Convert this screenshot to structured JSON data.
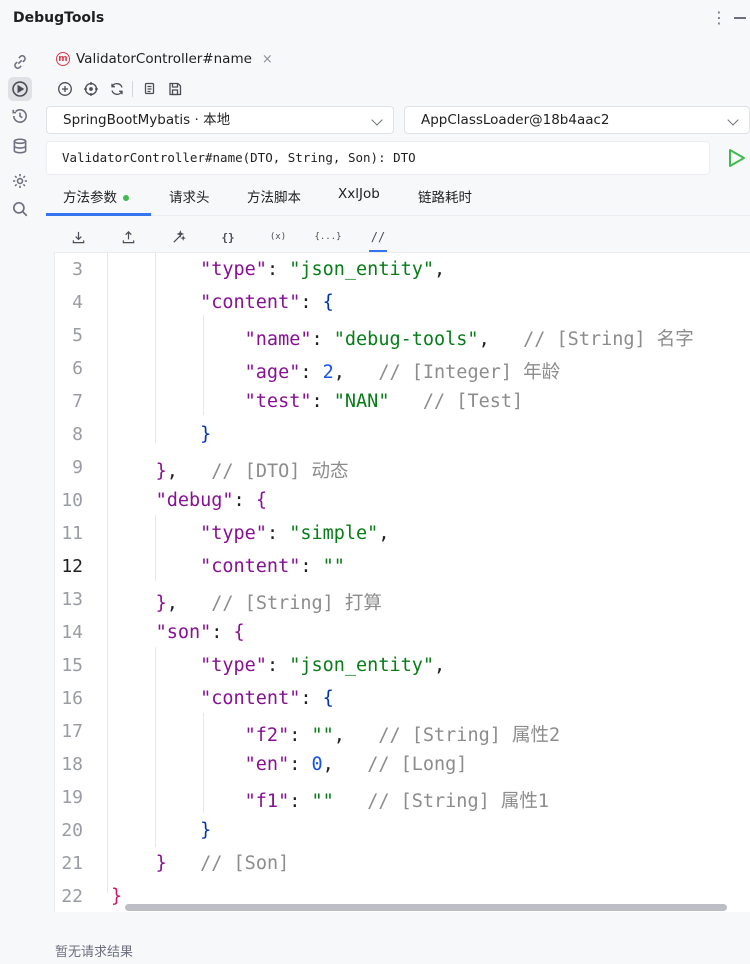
{
  "app": {
    "title": "DebugTools"
  },
  "tab": {
    "icon_letter": "m",
    "label": "ValidatorController#name",
    "close": "×"
  },
  "selects": {
    "project": "SpringBootMybatis · 本地",
    "classloader": "AppClassLoader@18b4aac2"
  },
  "signature": "ValidatorController#name(DTO, String, Son): DTO",
  "subtabs": [
    "方法参数",
    "请求头",
    "方法脚本",
    "XxlJob",
    "链路耗时"
  ],
  "editor_tools": [
    "{}",
    "(x)",
    "{...}",
    "//"
  ],
  "code": {
    "line_numbers": [
      "3",
      "4",
      "5",
      "6",
      "7",
      "8",
      "9",
      "10",
      "11",
      "12",
      "13",
      "14",
      "15",
      "16",
      "17",
      "18",
      "19",
      "20",
      "21",
      "22"
    ],
    "current_line": "12",
    "comments": {
      "name": "// [String] 名字",
      "age": "// [Integer] 年龄",
      "test": "// [Test]",
      "dto": "// [DTO] 动态",
      "debug": "// [String] 打算",
      "f2": "// [String] 属性2",
      "en": "// [Long]",
      "f1": "// [String] 属性1",
      "son": "// [Son]"
    },
    "keys": {
      "type": "\"type\"",
      "content": "\"content\"",
      "name": "\"name\"",
      "age": "\"age\"",
      "test": "\"test\"",
      "debug": "\"debug\"",
      "son": "\"son\"",
      "f2": "\"f2\"",
      "en": "\"en\"",
      "f1": "\"f1\""
    },
    "values": {
      "json_entity": "\"json_entity\"",
      "debug_tools": "\"debug-tools\"",
      "age": "2",
      "nan": "\"NAN\"",
      "simple": "\"simple\"",
      "empty": "\"\"",
      "en": "0"
    }
  },
  "result_text": "暂无请求结果"
}
